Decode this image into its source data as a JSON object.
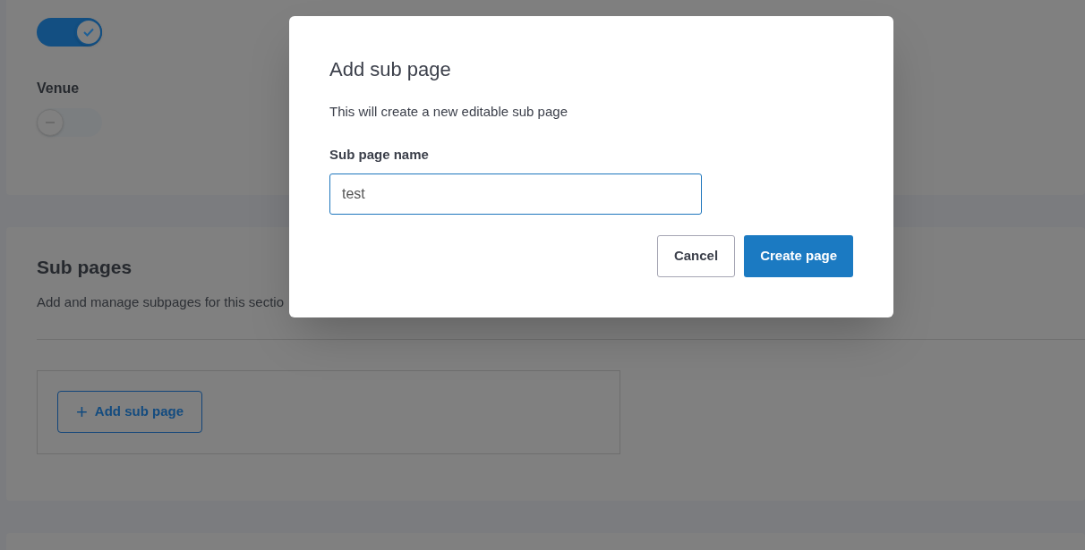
{
  "settings_card": {
    "items": [
      {
        "kind": "toggle",
        "on": true
      },
      {
        "kind": "label",
        "text": "Venue"
      },
      {
        "kind": "toggle",
        "on": false
      }
    ]
  },
  "sub_pages_card": {
    "title": "Sub pages",
    "description": "Add and manage subpages for this sectio",
    "add_button": {
      "icon": "+",
      "label": "Add sub page"
    }
  },
  "dialog": {
    "title": "Add sub page",
    "description": "This will create a new editable sub page",
    "field_label": "Sub page name",
    "field_value": "test",
    "buttons": [
      {
        "kind": "secondary",
        "label": "Cancel"
      },
      {
        "kind": "primary",
        "label": "Create page"
      }
    ]
  }
}
